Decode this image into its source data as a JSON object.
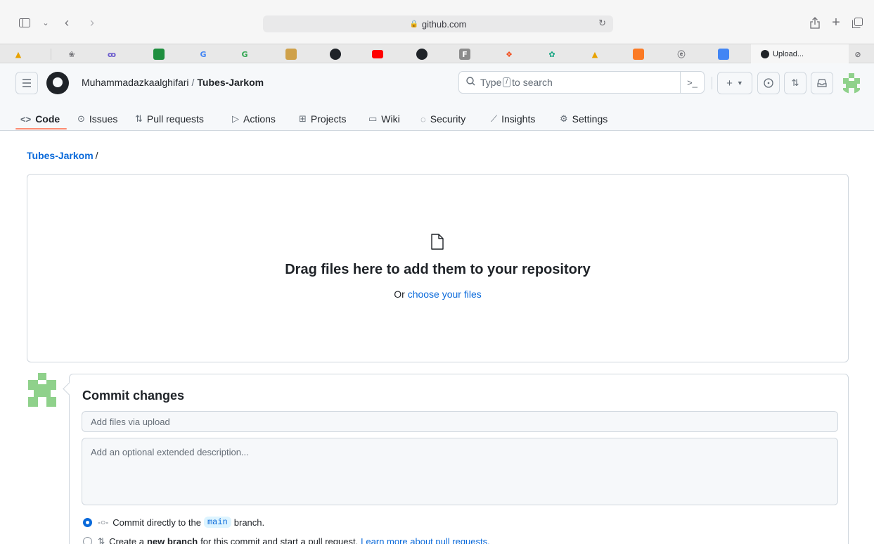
{
  "browser": {
    "url": "github.com",
    "active_tab_label": "Upload..."
  },
  "header": {
    "owner": "Muhammadazkaalghifari",
    "separator": "/",
    "repo": "Tubes-Jarkom",
    "search_prefix": "Type",
    "search_key": "/",
    "search_suffix": "to search"
  },
  "nav": {
    "tabs": [
      {
        "label": "Code",
        "icon": "code-icon"
      },
      {
        "label": "Issues",
        "icon": "issue-icon"
      },
      {
        "label": "Pull requests",
        "icon": "pull-request-icon"
      },
      {
        "label": "Actions",
        "icon": "play-icon"
      },
      {
        "label": "Projects",
        "icon": "table-icon"
      },
      {
        "label": "Wiki",
        "icon": "book-icon"
      },
      {
        "label": "Security",
        "icon": "shield-icon"
      },
      {
        "label": "Insights",
        "icon": "graph-icon"
      },
      {
        "label": "Settings",
        "icon": "gear-icon"
      }
    ]
  },
  "breadcrumb": {
    "repo": "Tubes-Jarkom",
    "sep": "/"
  },
  "dropzone": {
    "title": "Drag files here to add them to your repository",
    "or_text": "Or",
    "choose_link": "choose your files"
  },
  "commit": {
    "title": "Commit changes",
    "summary_placeholder": "Add files via upload",
    "description_placeholder": "Add an optional extended description...",
    "option_direct_prefix": "Commit directly to the",
    "option_direct_branch": "main",
    "option_direct_suffix": "branch.",
    "option_new_prefix": "Create a",
    "option_new_bold": "new branch",
    "option_new_suffix": "for this commit and start a pull request.",
    "option_new_link": "Learn more about pull requests."
  },
  "colors": {
    "accent": "#0969da",
    "nav_underline": "#fd8c73",
    "avatar": "#8fd18b"
  }
}
